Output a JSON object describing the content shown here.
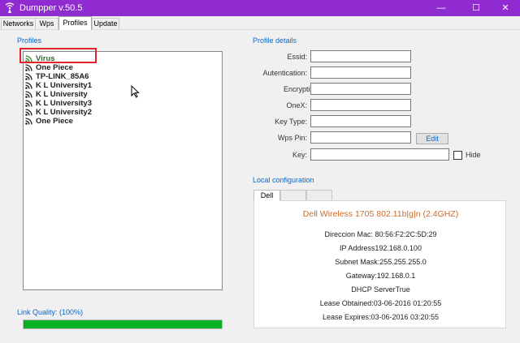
{
  "window": {
    "title": "Dumpper v.50.5",
    "minimize_glyph": "—",
    "maximize_glyph": "☐",
    "close_glyph": "✕",
    "icon": "wifi-antenna-icon"
  },
  "tabs": [
    {
      "label": "Networks",
      "active": false
    },
    {
      "label": "Wps",
      "active": false
    },
    {
      "label": "Profiles",
      "active": true
    },
    {
      "label": "Update",
      "active": false
    }
  ],
  "profiles": {
    "section_label": "Profiles",
    "items": [
      {
        "name": "Virus",
        "selected": true
      },
      {
        "name": "One Piece",
        "selected": false
      },
      {
        "name": "TP-LINK_85A6",
        "selected": false
      },
      {
        "name": "K L University1",
        "selected": false
      },
      {
        "name": "K L University",
        "selected": false
      },
      {
        "name": "K L University3",
        "selected": false
      },
      {
        "name": "K L University2",
        "selected": false
      },
      {
        "name": "One Piece",
        "selected": false
      }
    ],
    "item_icon": "wifi-signal-icon"
  },
  "profile_details": {
    "section_label": "Profile details",
    "fields": [
      {
        "label": "Essid:",
        "value": ""
      },
      {
        "label": "Autentication:",
        "value": ""
      },
      {
        "label": "Encryption:",
        "value": ""
      },
      {
        "label": "OneX:",
        "value": ""
      },
      {
        "label": "Key Type:",
        "value": ""
      },
      {
        "label": "Wps Pin:",
        "value": ""
      },
      {
        "label": "Key:",
        "value": ""
      }
    ],
    "edit_label": "Edit",
    "hide_label": "Hide",
    "hide_checked": false
  },
  "local_config": {
    "section_label": "Local configuration",
    "tabs": [
      "Dell",
      "",
      ""
    ],
    "adapter": "Dell Wireless 1705 802.11b|g|n (2.4GHZ)",
    "lines": [
      "Direccion Mac: 80:56:F2:2C:5D:29",
      "IP Address192.168.0.100",
      "Subnet Mask:255.255.255.0",
      "Gateway:192.168.0.1",
      "DHCP ServerTrue",
      "Lease Obtained:03-06-2016 01:20:55",
      "Lease Expires:03-06-2016 03:20:55"
    ]
  },
  "link_quality": {
    "label": "Link Quality: (100%)",
    "percent": 100
  },
  "colors": {
    "titlebar": "#8f2bd1",
    "accent_label": "#0d67c8",
    "adapter_text": "#d06a2a",
    "progress_fill": "#06b025",
    "highlight": "#e0242c"
  }
}
